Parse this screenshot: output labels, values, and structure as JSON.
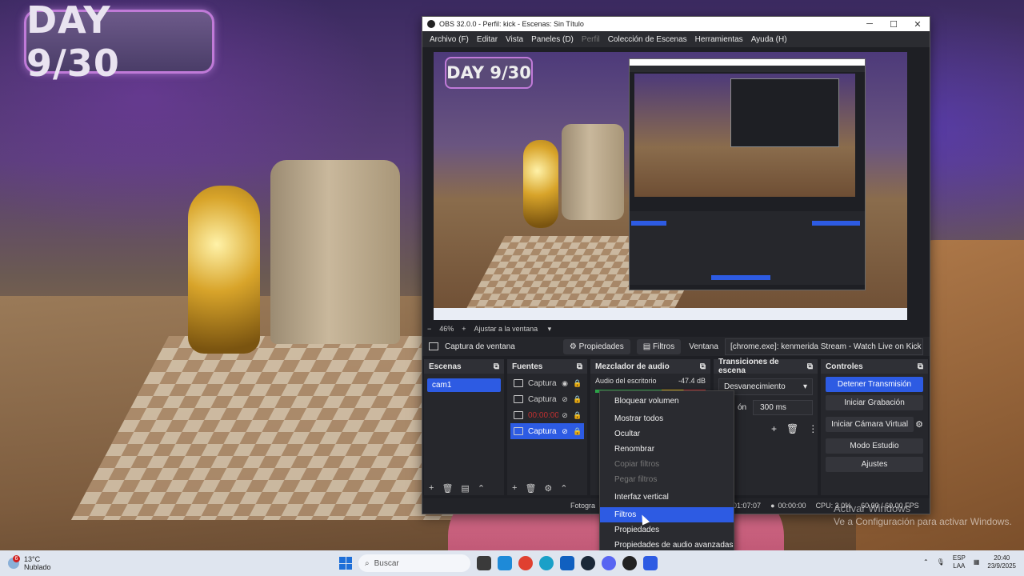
{
  "overlay": {
    "day_badge": "DAY 9/30"
  },
  "obs": {
    "title": "OBS 32.0.0 - Perfil: kick - Escenas: Sin Título",
    "window_buttons": {
      "minimize": "─",
      "maximize": "☐",
      "close": "✕"
    },
    "menu": [
      "Archivo (F)",
      "Editar",
      "Vista",
      "Paneles (D)",
      "Perfil",
      "Colección de Escenas",
      "Herramientas",
      "Ayuda (H)"
    ],
    "preview_day_badge": "DAY 9/30",
    "zoom": {
      "minus": "−",
      "value": "46%",
      "plus": "+",
      "fit": "Ajustar a la ventana"
    },
    "source_bar": {
      "source_name": "Captura de ventana",
      "properties": "Propiedades",
      "filters": "Filtros",
      "window_label": "Ventana",
      "window_value": "[chrome.exe]: kenmerida Stream - Watch Live on Kick - Google Chron"
    },
    "docks": {
      "scenes": {
        "title": "Escenas",
        "items": [
          "cam1"
        ]
      },
      "sources": {
        "title": "Fuentes",
        "items": [
          {
            "label": "Captura d",
            "selected": false
          },
          {
            "label": "Captura d",
            "selected": false
          },
          {
            "label": "00:00:00",
            "selected": false
          },
          {
            "label": "Captura d",
            "selected": true
          }
        ]
      },
      "mixer": {
        "title": "Mezclador de audio",
        "channel": "Audio del escritorio",
        "level": "-47.4 dB"
      },
      "transitions": {
        "title": "Transiciones de escena",
        "selected": "Desvanecimiento",
        "duration_label": "ón",
        "duration": "300 ms"
      },
      "controls": {
        "title": "Controles",
        "buttons": [
          "Detener Transmisión",
          "Iniciar Grabación",
          "Iniciar Cámara Virtual",
          "Modo Estudio",
          "Ajustes"
        ]
      }
    },
    "status": {
      "frames": "Fotogra",
      "stream_time": "01:07:07",
      "rec_time": "00:00:00",
      "cpu": "CPU: 3.0%",
      "fps": "60.00 / 60.00 FPS"
    }
  },
  "context_menu": {
    "items": [
      {
        "label": "Bloquear volumen",
        "disabled": false,
        "highlight": false
      },
      {
        "label": "Mostrar todos",
        "disabled": false,
        "highlight": false
      },
      {
        "label": "Ocultar",
        "disabled": false,
        "highlight": false
      },
      {
        "label": "Renombrar",
        "disabled": false,
        "highlight": false
      },
      {
        "label": "Copiar filtros",
        "disabled": true,
        "highlight": false
      },
      {
        "label": "Pegar filtros",
        "disabled": true,
        "highlight": false
      },
      {
        "label": "Interfaz vertical",
        "disabled": false,
        "highlight": false
      },
      {
        "label": "Filtros",
        "disabled": false,
        "highlight": true
      },
      {
        "label": "Propiedades",
        "disabled": false,
        "highlight": false
      },
      {
        "label": "Propiedades de audio avanzadas",
        "disabled": false,
        "highlight": false
      }
    ]
  },
  "watermark": {
    "line1": "Activar Windows",
    "line2": "Ve a Configuración para activar Windows."
  },
  "taskbar": {
    "weather_temp": "13°C",
    "weather_desc": "Nublado",
    "notif_count": "6",
    "search_placeholder": "Buscar",
    "lang": "ESP",
    "lang2": "LAA",
    "time": "20:40",
    "date": "23/9/2025"
  },
  "colors": {
    "accent": "#2d5be3",
    "panel": "#26272c",
    "window": "#1e1f24"
  }
}
